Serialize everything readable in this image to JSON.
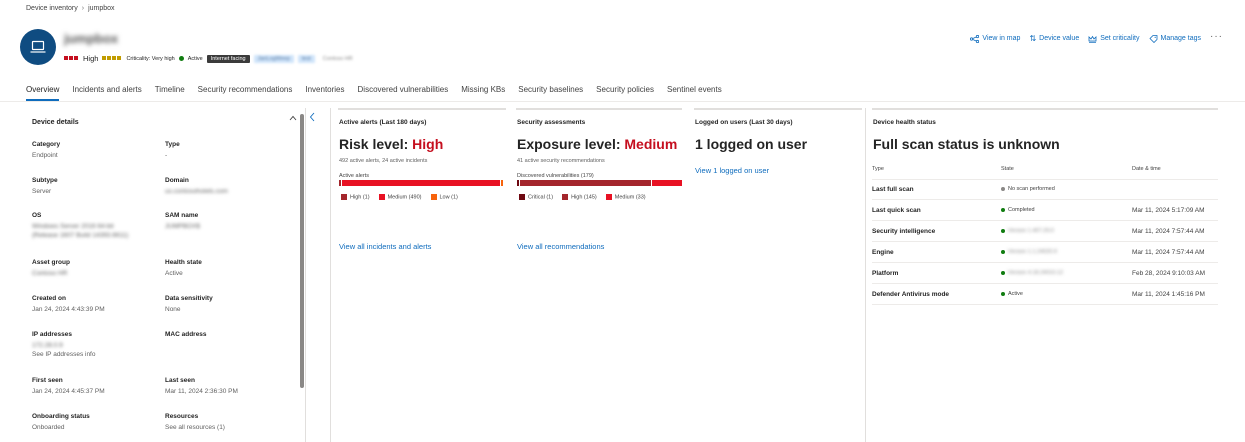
{
  "breadcrumb": {
    "parent": "Device inventory",
    "current": "jumpbox"
  },
  "header": {
    "device_name": "jumpbox",
    "risk_label": "High",
    "criticality_label": "Criticality: Very high",
    "status_label": "Active",
    "tags": [
      "Internet facing",
      "JanLogWeep",
      "test",
      "Contoso HR"
    ],
    "actions": [
      "View in map",
      "Device value",
      "Set criticality",
      "Manage tags"
    ],
    "more": "···"
  },
  "tabs": [
    "Overview",
    "Incidents and alerts",
    "Timeline",
    "Security recommendations",
    "Inventories",
    "Discovered vulnerabilities",
    "Missing KBs",
    "Security baselines",
    "Security policies",
    "Sentinel events"
  ],
  "details": {
    "title": "Device details",
    "fields": [
      {
        "label": "Category",
        "value": "Endpoint"
      },
      {
        "label": "Type",
        "value": "-"
      },
      {
        "label": "Subtype",
        "value": "Server"
      },
      {
        "label": "Domain",
        "value": "us.contosohotels.com"
      },
      {
        "label": "OS",
        "value": "Windows Server 2016 64-bit",
        "value2": "(Release 1607 Build 14393.6611)"
      },
      {
        "label": "SAM name",
        "value": "JUMPBOX$"
      },
      {
        "label": "Asset group",
        "value": "Contoso HR"
      },
      {
        "label": "Health state",
        "value": "Active"
      },
      {
        "label": "Created on",
        "value": "Jan 24, 2024 4:43:39 PM"
      },
      {
        "label": "Data sensitivity",
        "value": "None"
      },
      {
        "label": "IP addresses",
        "value": "172.28.0.9",
        "link": "See IP addresses info"
      },
      {
        "label": "MAC address",
        "value": ""
      },
      {
        "label": "First seen",
        "value": "Jan 24, 2024 4:45:37 PM"
      },
      {
        "label": "Last seen",
        "value": "Mar 11, 2024 2:36:30 PM"
      },
      {
        "label": "Onboarding status",
        "value": "Onboarded"
      },
      {
        "label": "Resources",
        "link": "See all resources (1)"
      }
    ]
  },
  "alerts": {
    "title": "Active alerts (Last 180 days)",
    "headline_prefix": "Risk level: ",
    "headline_value": "High",
    "sub": "492 active alerts, 24 active incidents",
    "bar_label": "Active alerts",
    "legend": [
      {
        "label": "High (1)",
        "color": "#a4262c"
      },
      {
        "label": "Medium (490)",
        "color": "#e81123"
      },
      {
        "label": "Low (1)",
        "color": "#f7630c"
      }
    ],
    "link": "View all incidents and alerts"
  },
  "assessments": {
    "title": "Security assessments",
    "headline_prefix": "Exposure level: ",
    "headline_value": "Medium",
    "sub": "41 active security recommendations",
    "bar_label": "Discovered vulnerabilities (179)",
    "legend": [
      {
        "label": "Critical (1)",
        "color": "#6e0811"
      },
      {
        "label": "High (145)",
        "color": "#a4262c"
      },
      {
        "label": "Medium (33)",
        "color": "#e81123"
      }
    ],
    "link": "View all recommendations"
  },
  "logged_on": {
    "title": "Logged on users (Last 30 days)",
    "headline": "1 logged on user",
    "link": "View 1 logged on user"
  },
  "health": {
    "title": "Device health status",
    "headline": "Full scan status is unknown",
    "columns": [
      "Type",
      "State",
      "Date & time"
    ],
    "rows": [
      {
        "type": "Last full scan",
        "state": "No scan performed",
        "status": "none",
        "date": ""
      },
      {
        "type": "Last quick scan",
        "state": "Completed",
        "status": "ok",
        "date": "Mar 11, 2024 5:17:09 AM"
      },
      {
        "type": "Security intelligence",
        "state": "Version 1.407.29.0",
        "status": "ok",
        "blur": true,
        "date": "Mar 11, 2024 7:57:44 AM"
      },
      {
        "type": "Engine",
        "state": "Version 1.1.24020.9",
        "status": "ok",
        "blur": true,
        "date": "Mar 11, 2024 7:57:44 AM"
      },
      {
        "type": "Platform",
        "state": "Version 4.18.24010.12",
        "status": "ok",
        "blur": true,
        "date": "Feb 28, 2024 9:10:03 AM"
      },
      {
        "type": "Defender Antivirus mode",
        "state": "Active",
        "status": "ok",
        "date": "Mar 11, 2024 1:45:16 PM"
      }
    ]
  },
  "colors": {
    "accent": "#0f6cbd",
    "danger": "#c50f1f",
    "avatar": "#0f4c81"
  }
}
